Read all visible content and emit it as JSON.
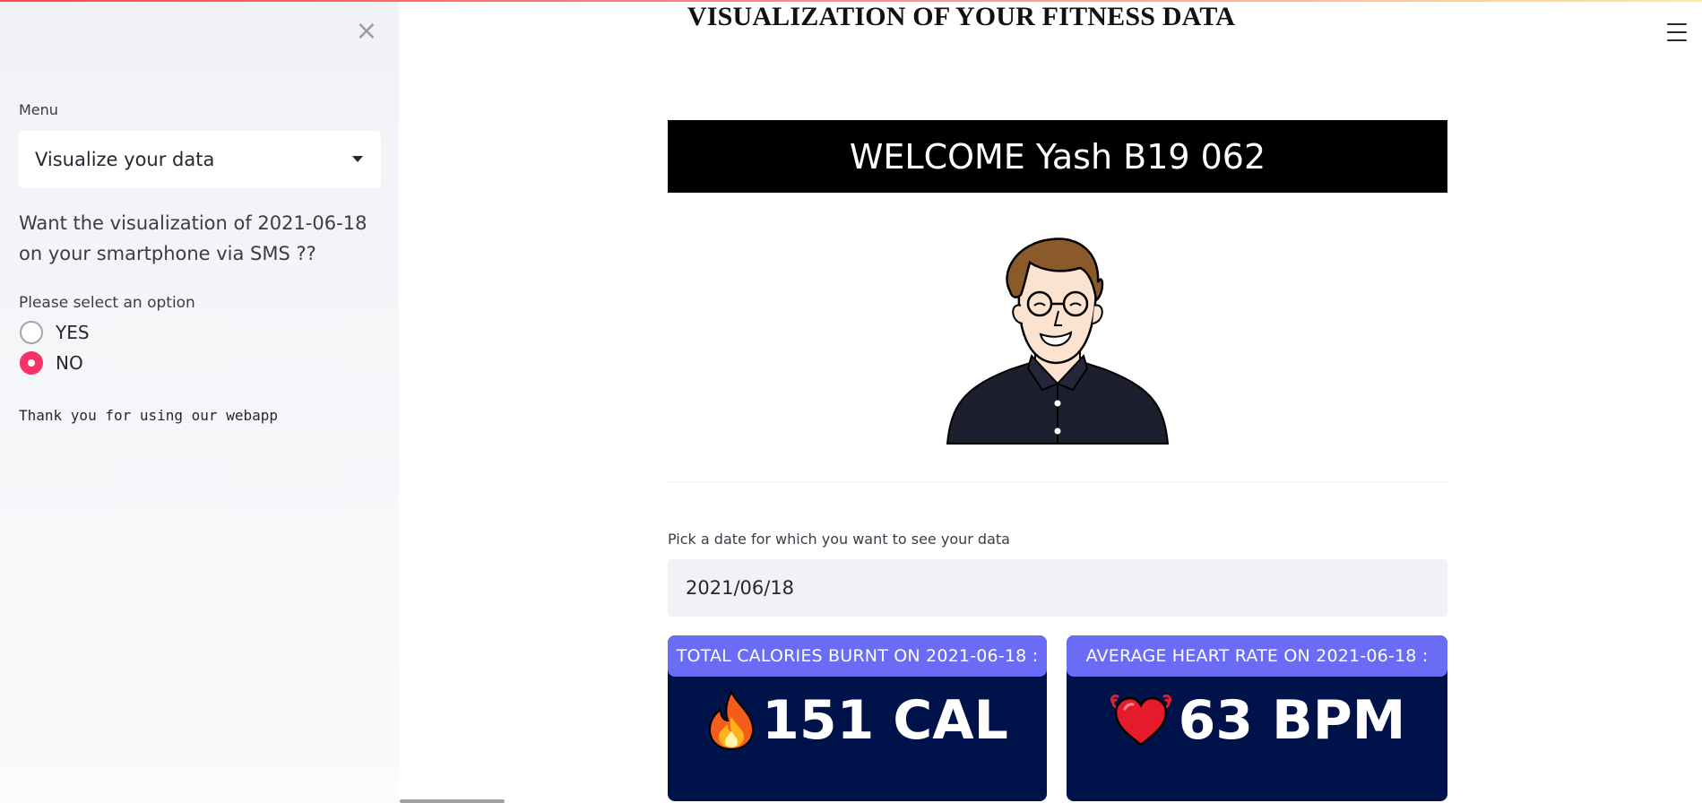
{
  "sidebar": {
    "close_icon": "close-icon",
    "menu_label": "Menu",
    "menu_selected": "Visualize your data",
    "sms_question": "Want the visualization of 2021-06-18 on your smartphone via SMS ??",
    "option_label": "Please select an option",
    "options": [
      {
        "label": "YES",
        "checked": false
      },
      {
        "label": "NO",
        "checked": true
      }
    ],
    "thanks": "Thank you for using our webapp"
  },
  "main": {
    "title": "VISUALIZATION OF YOUR FITNESS DATA",
    "welcome": "WELCOME Yash B19 062",
    "avatar_icon": "user-avatar-illustration",
    "date_label": "Pick a date for which you want to see your data",
    "date_value": "2021/06/18",
    "calories": {
      "header": "TOTAL CALORIES BURNT ON 2021-06-18 :",
      "value": "151 CAL",
      "icon": "fire-icon"
    },
    "heart_rate": {
      "header": "AVERAGE HEART RATE ON 2021-06-18 :",
      "value": "63 BPM",
      "icon": "heart-icon"
    },
    "menu_icon": "hamburger-menu-icon"
  },
  "colors": {
    "accent": "#f63366",
    "banner_bg": "#000000",
    "card_bg": "#00124a",
    "card_header": "#6b6cf5",
    "sidebar_bg": "#f0f2f6"
  }
}
